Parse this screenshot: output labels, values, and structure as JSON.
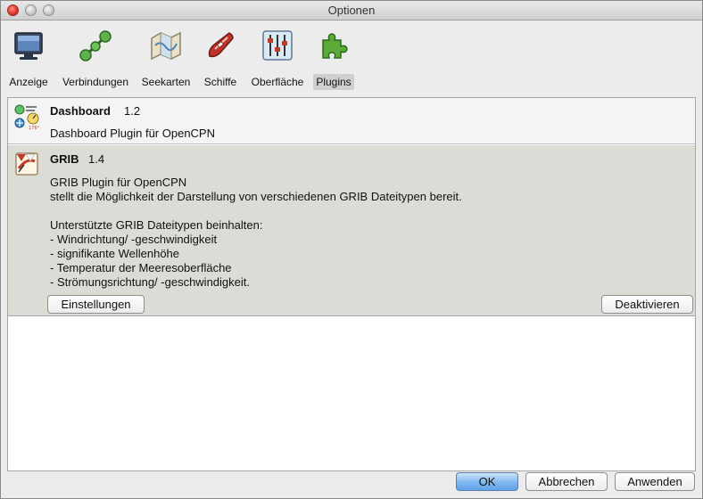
{
  "window": {
    "title": "Optionen"
  },
  "toolbar": {
    "items": [
      {
        "label": "Anzeige",
        "icon": "monitor-icon"
      },
      {
        "label": "Verbindungen",
        "icon": "connections-icon"
      },
      {
        "label": "Seekarten",
        "icon": "charts-map-icon"
      },
      {
        "label": "Schiffe",
        "icon": "ship-icon"
      },
      {
        "label": "Oberfläche",
        "icon": "sliders-icon"
      },
      {
        "label": "Plugins",
        "icon": "puzzle-icon",
        "active": true
      }
    ]
  },
  "plugins": [
    {
      "name": "Dashboard",
      "version": "1.2",
      "description": "Dashboard Plugin für OpenCPN",
      "icon": "dashboard-instruments-icon",
      "expanded": false
    },
    {
      "name": "GRIB",
      "version": "1.4",
      "description": "GRIB Plugin für OpenCPN\nstellt die Möglichkeit der Darstellung von verschiedenen GRIB Dateitypen bereit.\n\nUnterstützte GRIB Dateitypen beinhalten:\n- Windrichtung/ -geschwindigkeit\n- signifikante Wellenhöhe\n- Temperatur der Meeresoberfläche\n- Strömungsrichtung/ -geschwindigkeit.",
      "icon": "grib-weather-icon",
      "expanded": true,
      "settings_label": "Einstellungen",
      "toggle_label": "Deaktivieren"
    }
  ],
  "footer": {
    "ok_label": "OK",
    "cancel_label": "Abbrechen",
    "apply_label": "Anwenden"
  },
  "colors": {
    "selected_row": "#dcdcd6",
    "default_button": "#7eb6ef"
  }
}
